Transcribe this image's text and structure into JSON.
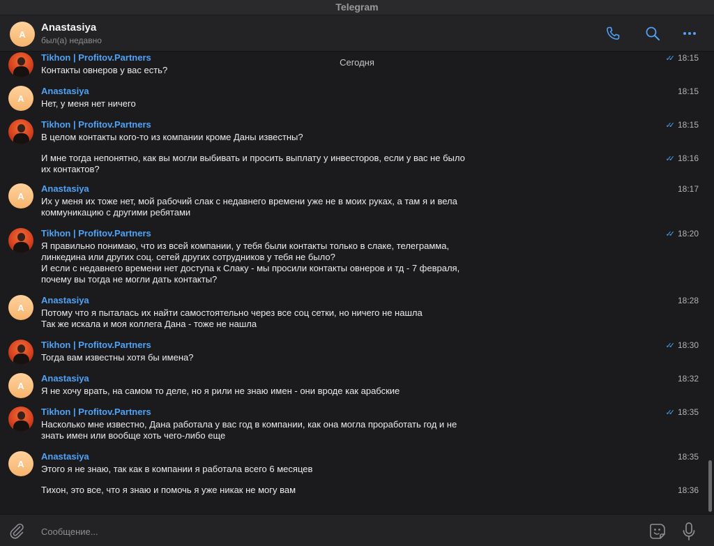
{
  "window": {
    "title": "Telegram"
  },
  "header": {
    "avatar_letter": "A",
    "name": "Anastasiya",
    "status": "был(а) недавно",
    "icons": [
      "phone-icon",
      "search-icon",
      "more-icon"
    ]
  },
  "date_separator": "Сегодня",
  "messages": [
    {
      "sender": "Tikhon | Profitov.Partners",
      "avatar": "photo",
      "text": "Контакты овнеров у вас есть?",
      "time": "18:15",
      "read": true
    },
    {
      "sender": "Anastasiya",
      "avatar": "A",
      "text": "Нет, у меня нет ничего",
      "time": "18:15",
      "read": false
    },
    {
      "sender": "Tikhon | Profitov.Partners",
      "avatar": "photo",
      "text": "В целом контакты кого-то из компании кроме Даны известны?",
      "time": "18:15",
      "read": true
    },
    {
      "sender": "",
      "avatar": "",
      "text": "И мне тогда непонятно, как вы могли выбивать и просить выплату у инвесторов, если у вас не было\nих контактов?",
      "time": "18:16",
      "read": true
    },
    {
      "sender": "Anastasiya",
      "avatar": "A",
      "text": "Их у меня их тоже нет, мой рабочий слак с недавнего времени уже не в моих руках, а там я и вела\nкоммуникацию с другими ребятами",
      "time": "18:17",
      "read": false
    },
    {
      "sender": "Tikhon | Profitov.Partners",
      "avatar": "photo",
      "text": "Я правильно понимаю, что из всей компании, у тебя были контакты только в слаке, телеграмма,\nлинкедина или других соц. сетей других сотрудников у тебя не было?\nИ если с недавнего времени нет доступа к Слаку - мы просили контакты овнеров и тд - 7 февраля,\nпочему вы тогда не могли дать контакты?",
      "time": "18:20",
      "read": true
    },
    {
      "sender": "Anastasiya",
      "avatar": "A",
      "text": "Потому что я пыталась их найти самостоятельно через все соц сетки, но ничего не нашла\nТак же искала и моя коллега Дана - тоже не нашла",
      "time": "18:28",
      "read": false
    },
    {
      "sender": "Tikhon | Profitov.Partners",
      "avatar": "photo",
      "text": "Тогда вам известны хотя бы имена?",
      "time": "18:30",
      "read": true
    },
    {
      "sender": "Anastasiya",
      "avatar": "A",
      "text": "Я не хочу врать, на самом то деле, но я рили не знаю имен - они вроде как арабские",
      "time": "18:32",
      "read": false
    },
    {
      "sender": "Tikhon | Profitov.Partners",
      "avatar": "photo",
      "text": "Насколько мне известно, Дана работала у вас год в компании, как она могла проработать год и не\nзнать имен или вообще хоть чего-либо еще",
      "time": "18:35",
      "read": true
    },
    {
      "sender": "Anastasiya",
      "avatar": "A",
      "text": "Этого я не знаю, так как в компании я работала всего 6 месяцев",
      "time": "18:35",
      "read": false
    },
    {
      "sender": "",
      "avatar": "",
      "text": "Тихон, это все, что я знаю и помочь я уже никак не могу вам",
      "time": "18:36",
      "read": false
    }
  ],
  "composer": {
    "placeholder": "Сообщение...",
    "icons": [
      "attach-icon",
      "sticker-icon",
      "microphone-icon"
    ]
  },
  "colors": {
    "accent": "#4fa3f7",
    "background": "#1b1b1d",
    "header": "#232325"
  }
}
